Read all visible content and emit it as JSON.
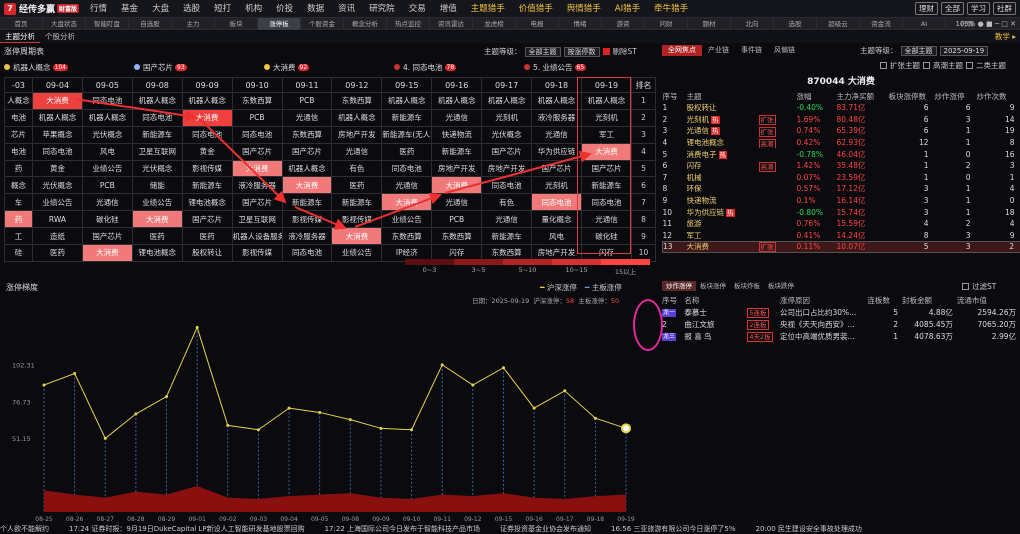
{
  "app": {
    "logo": "经传多赢",
    "logo_badge": "财富版"
  },
  "nav": [
    "行情",
    "基金",
    "大盘",
    "选股",
    "短打",
    "机构",
    "价投",
    "数据",
    "资讯",
    "研究院",
    "交易",
    "增值",
    "主题猎手",
    "价值猎手",
    "舆情猎手",
    "AI猎手",
    "牵牛猎手"
  ],
  "top_right": [
    "理财",
    "全部",
    "学习",
    "社群"
  ],
  "tabs": [
    "首页",
    "大盘状态",
    "智能盯盘",
    "自选股",
    "主力",
    "板块",
    "涨停板",
    "个股资金",
    "概念分析",
    "热点监控",
    "资讯雷达",
    "龙虎榜",
    "电报",
    "情绪",
    "游资",
    "问财",
    "题材",
    "北向",
    "选股",
    "超级云",
    "资金流",
    "AI",
    "行情"
  ],
  "active_tab": 6,
  "win_ctrl": "105% ● ■ ─ □ ✕",
  "subtabs": [
    "主题分析",
    "个股分析"
  ],
  "subtab_right": "教学 ▸",
  "left_panel_title": "涨停周期表",
  "controls": {
    "level_label": "主题等级：",
    "level_value": "全部主题",
    "sort_value": "按涨停数",
    "remove_st": "剔除ST"
  },
  "chips": [
    {
      "name": "机器人概念",
      "count": "104",
      "color": "#e9c048"
    },
    {
      "name": "国产芯片",
      "count": "93",
      "color": "#8fb4ff"
    },
    {
      "name": "大消费",
      "count": "92",
      "color": "#f5c242"
    },
    {
      "name": "4. 同态电池",
      "count": "78",
      "color": "#cc3333"
    },
    {
      "name": "5. 业绩公告",
      "count": "65",
      "color": "#cc3333"
    }
  ],
  "grid": {
    "headers": [
      "-03",
      "09-04",
      "09-05",
      "09-08",
      "09-09",
      "09-10",
      "09-11",
      "09-12",
      "09-15",
      "09-16",
      "09-17",
      "09-18",
      "09-19",
      "排名"
    ],
    "rows": [
      [
        "人概念",
        "大消费",
        "同态电池",
        "机器人概念",
        "机器人概念",
        "东数西算",
        "PCB",
        "东数西算",
        "机器人概念",
        "机器人概念",
        "机器人概念",
        "机器人概念",
        "机器人概念",
        "1"
      ],
      [
        "电池",
        "机器人概念",
        "机器人概念",
        "同态电池",
        "大消费",
        "PCB",
        "光通信",
        "机器人概念",
        "新能源车",
        "光通信",
        "光刻机",
        "液冷服务器",
        "光刻机",
        "2"
      ],
      [
        "芯片",
        "苹果概念",
        "光伏概念",
        "新能源车",
        "同态电池",
        "同态电池",
        "东数西算",
        "房地产开发",
        "新能源车(无人驾驶)",
        "快递物流",
        "光伏概念",
        "光通信",
        "军工",
        "3"
      ],
      [
        "电池",
        "同态电池",
        "风电",
        "卫星互联网",
        "黄金",
        "国产芯片",
        "国产芯片",
        "光通信",
        "医药",
        "新能源车",
        "国产芯片",
        "华为供应链",
        "大消费",
        "4"
      ],
      [
        "药",
        "黄金",
        "业绩公告",
        "光伏概念",
        "影视传媒",
        "大消费",
        "机器人概念",
        "有色",
        "同态电池",
        "房地产开发",
        "房地产开发",
        "国产芯片",
        "国产芯片",
        "5"
      ],
      [
        "概念",
        "光伏概念",
        "PCB",
        "储能",
        "新能源车",
        "液冷服务器",
        "大消费",
        "医药",
        "光通信",
        "大消费",
        "同态电池",
        "光刻机",
        "新能源车",
        "6"
      ],
      [
        "车",
        "业绩公告",
        "光通信",
        "业绩公告",
        "锂电池概念",
        "国产芯片",
        "新能源车",
        "新能源车",
        "大消费",
        "光通信",
        "有色",
        "同态电池",
        "同态电池",
        "7"
      ],
      [
        "药",
        "RWA",
        "碳化硅",
        "大消费",
        "国产芯片",
        "卫星互联网",
        "影视传媒",
        "影视传媒",
        "业绩公告",
        "PCB",
        "光通信",
        "量化概念",
        "光通信",
        "8"
      ],
      [
        "工",
        "造纸",
        "国产芯片",
        "医药",
        "医药",
        "机器人设备服务",
        "液冷服务器",
        "大消费",
        "东数西算",
        "东数西算",
        "新能源车",
        "风电",
        "碳化硅",
        "9"
      ],
      [
        "硅",
        "医药",
        "大消费",
        "锂电池概念",
        "股权转让",
        "影视传媒",
        "同态电池",
        "业绩公告",
        "IP经济",
        "闪存",
        "东数西算",
        "房地产开发",
        "闪存",
        "10"
      ]
    ],
    "highlights": {
      "0-1": "h1",
      "1-4": "h1",
      "3-12": "h2",
      "4-5": "h2",
      "5-6": "h2",
      "5-9": "h2",
      "6-8": "h2",
      "6-11": "h2",
      "7-3": "h2",
      "8-7": "h2",
      "9-2": "h2",
      "0-13": "",
      "7-0": "h2",
      "9-1": ""
    }
  },
  "legend": {
    "colors": [
      "#5a1010",
      "#8a1a1a",
      "#b52222",
      "#d83030",
      "#ff4444"
    ],
    "labels": [
      "0~3",
      "3~5",
      "5~10",
      "10~15",
      "15以上"
    ]
  },
  "right_panel": {
    "tabs": [
      "全网焦点",
      "产业链",
      "事件链",
      "风偏链"
    ],
    "active_tab": 0,
    "level_label": "主题等级：",
    "level_value": "全部主题",
    "date": "2025-09-19",
    "options": [
      "扩张主题",
      "高潮主题",
      "二类主题"
    ],
    "title": "870044 大消费",
    "headers": [
      "序号",
      "主题",
      "",
      "涨幅",
      "主力净买额",
      "板块涨停数",
      "炒作涨停",
      "炒作次数"
    ],
    "rows": [
      {
        "no": "1",
        "name": "股权转让",
        "tag": "",
        "tagc": "",
        "chg": "-0.40%",
        "dir": "down",
        "flow": "83.71亿",
        "a": "6",
        "b": "6",
        "c": "9"
      },
      {
        "no": "2",
        "name": "光刻机",
        "tag": "热",
        "tagc": "t1",
        "tag2": "扩张",
        "chg": "1.69%",
        "dir": "up",
        "flow": "80.48亿",
        "a": "6",
        "b": "3",
        "c": "14"
      },
      {
        "no": "3",
        "name": "光通信",
        "tag": "热",
        "tagc": "t1",
        "tag2": "扩张",
        "chg": "0.74%",
        "dir": "up",
        "flow": "65.39亿",
        "a": "6",
        "b": "1",
        "c": "19"
      },
      {
        "no": "4",
        "name": "锂电池概念",
        "tag": "",
        "tagc": "",
        "tag2": "高潮",
        "chg": "0.42%",
        "dir": "up",
        "flow": "62.93亿",
        "a": "12",
        "b": "1",
        "c": "8"
      },
      {
        "no": "5",
        "name": "消费电子",
        "tag": "热",
        "tagc": "t1",
        "chg": "-0.78%",
        "dir": "down",
        "flow": "46.04亿",
        "a": "1",
        "b": "0",
        "c": "16"
      },
      {
        "no": "6",
        "name": "闪存",
        "tag": "",
        "tagc": "",
        "tag2": "高潮",
        "chg": "1.42%",
        "dir": "up",
        "flow": "35.48亿",
        "a": "1",
        "b": "2",
        "c": "3"
      },
      {
        "no": "7",
        "name": "机械",
        "tag": "",
        "tagc": "",
        "chg": "0.07%",
        "dir": "up",
        "flow": "23.59亿",
        "a": "1",
        "b": "0",
        "c": "1"
      },
      {
        "no": "8",
        "name": "环保",
        "tag": "",
        "tagc": "",
        "chg": "0.57%",
        "dir": "up",
        "flow": "17.12亿",
        "a": "3",
        "b": "1",
        "c": "4"
      },
      {
        "no": "9",
        "name": "快递物流",
        "tag": "",
        "tagc": "",
        "chg": "0.1%",
        "dir": "up",
        "flow": "16.14亿",
        "a": "3",
        "b": "1",
        "c": "0"
      },
      {
        "no": "10",
        "name": "华为供应链",
        "tag": "热",
        "tagc": "t1",
        "chg": "-0.80%",
        "dir": "down",
        "flow": "15.74亿",
        "a": "3",
        "b": "1",
        "c": "18"
      },
      {
        "no": "11",
        "name": "旅游",
        "tag": "",
        "tagc": "",
        "chg": "0.76%",
        "dir": "up",
        "flow": "15.59亿",
        "a": "4",
        "b": "2",
        "c": "4"
      },
      {
        "no": "12",
        "name": "军工",
        "tag": "",
        "tagc": "",
        "chg": "0.41%",
        "dir": "up",
        "flow": "14.24亿",
        "a": "8",
        "b": "3",
        "c": "9"
      },
      {
        "no": "13",
        "name": "大消费",
        "tag": "",
        "tagc": "",
        "tag2": "扩张",
        "chg": "0.11%",
        "dir": "up",
        "flow": "10.07亿",
        "a": "5",
        "b": "3",
        "c": "2"
      }
    ]
  },
  "bottom_right": {
    "tabs": [
      "炒作涨停",
      "板块涨停",
      "板块炸板",
      "板块跌停"
    ],
    "filter": "过滤ST",
    "headers": [
      "序号",
      "名称",
      "",
      "涨停原因",
      "连板数",
      "封板金额",
      "流通市值"
    ],
    "rows": [
      {
        "badge": "龙一",
        "name": "泰慕士",
        "tag": "5连板",
        "reason": "公司出口占比约30%...",
        "boards": "5",
        "seal": "4.88亿",
        "cap": "2594.26万"
      },
      {
        "badge": "2",
        "name": "曲江文旅",
        "tag": "2连板",
        "reason": "央视《天天向西安》...",
        "boards": "2",
        "seal": "4085.45万",
        "cap": "7065.20万"
      },
      {
        "badge": "龙三",
        "name": "报 喜 鸟",
        "tag": "4天2板",
        "reason": "定位中高端优质男装...",
        "boards": "1",
        "seal": "4078.63万",
        "cap": "2.99亿"
      }
    ]
  },
  "chart_header": {
    "title": "涨停梯度",
    "legend": [
      "沪深涨停",
      "主板涨停"
    ],
    "date": "日期：2025-09-19",
    "counts_label": "沪深涨停：",
    "counts_value": "58",
    "main_label": "主板涨停：",
    "main_value": "50"
  },
  "chart_data": {
    "type": "line",
    "categories": [
      "08-25",
      "08-26",
      "08-27",
      "08-28",
      "08-29",
      "09-01",
      "09-02",
      "09-03",
      "09-04",
      "09-05",
      "09-08",
      "09-09",
      "09-10",
      "09-11",
      "09-12",
      "09-15",
      "09-16",
      "09-17",
      "09-18",
      "09-19"
    ],
    "series": [
      {
        "name": "沪深涨停",
        "values": [
          88,
          96,
          51,
          68,
          80,
          128,
          60,
          57,
          72,
          69,
          64,
          58,
          57,
          102,
          88,
          100,
          72,
          84,
          65,
          58
        ]
      },
      {
        "name": "主板涨停",
        "values": [
          15,
          12,
          10,
          14,
          12,
          18,
          10,
          9,
          11,
          12,
          13,
          10,
          9,
          12,
          11,
          13,
          10,
          9,
          11,
          12
        ]
      }
    ],
    "yticks": [
      51.15,
      76.73,
      102.31
    ],
    "ylim": [
      0,
      140
    ],
    "grid": false,
    "legend_position": "top-right"
  },
  "ticker": [
    "个人欲不能解约",
    "17:24 证券时报：9月19日DukeCapital LP新设人工智能研发基地股票回购",
    "17:22 上海国际公司今日发布于智能科技产品市场",
    "证券投资基金业协会发布通知",
    "16:56 三亚旅游有限公司今日涨停了5%",
    "20:00 民生建设安全事故处理成功"
  ]
}
